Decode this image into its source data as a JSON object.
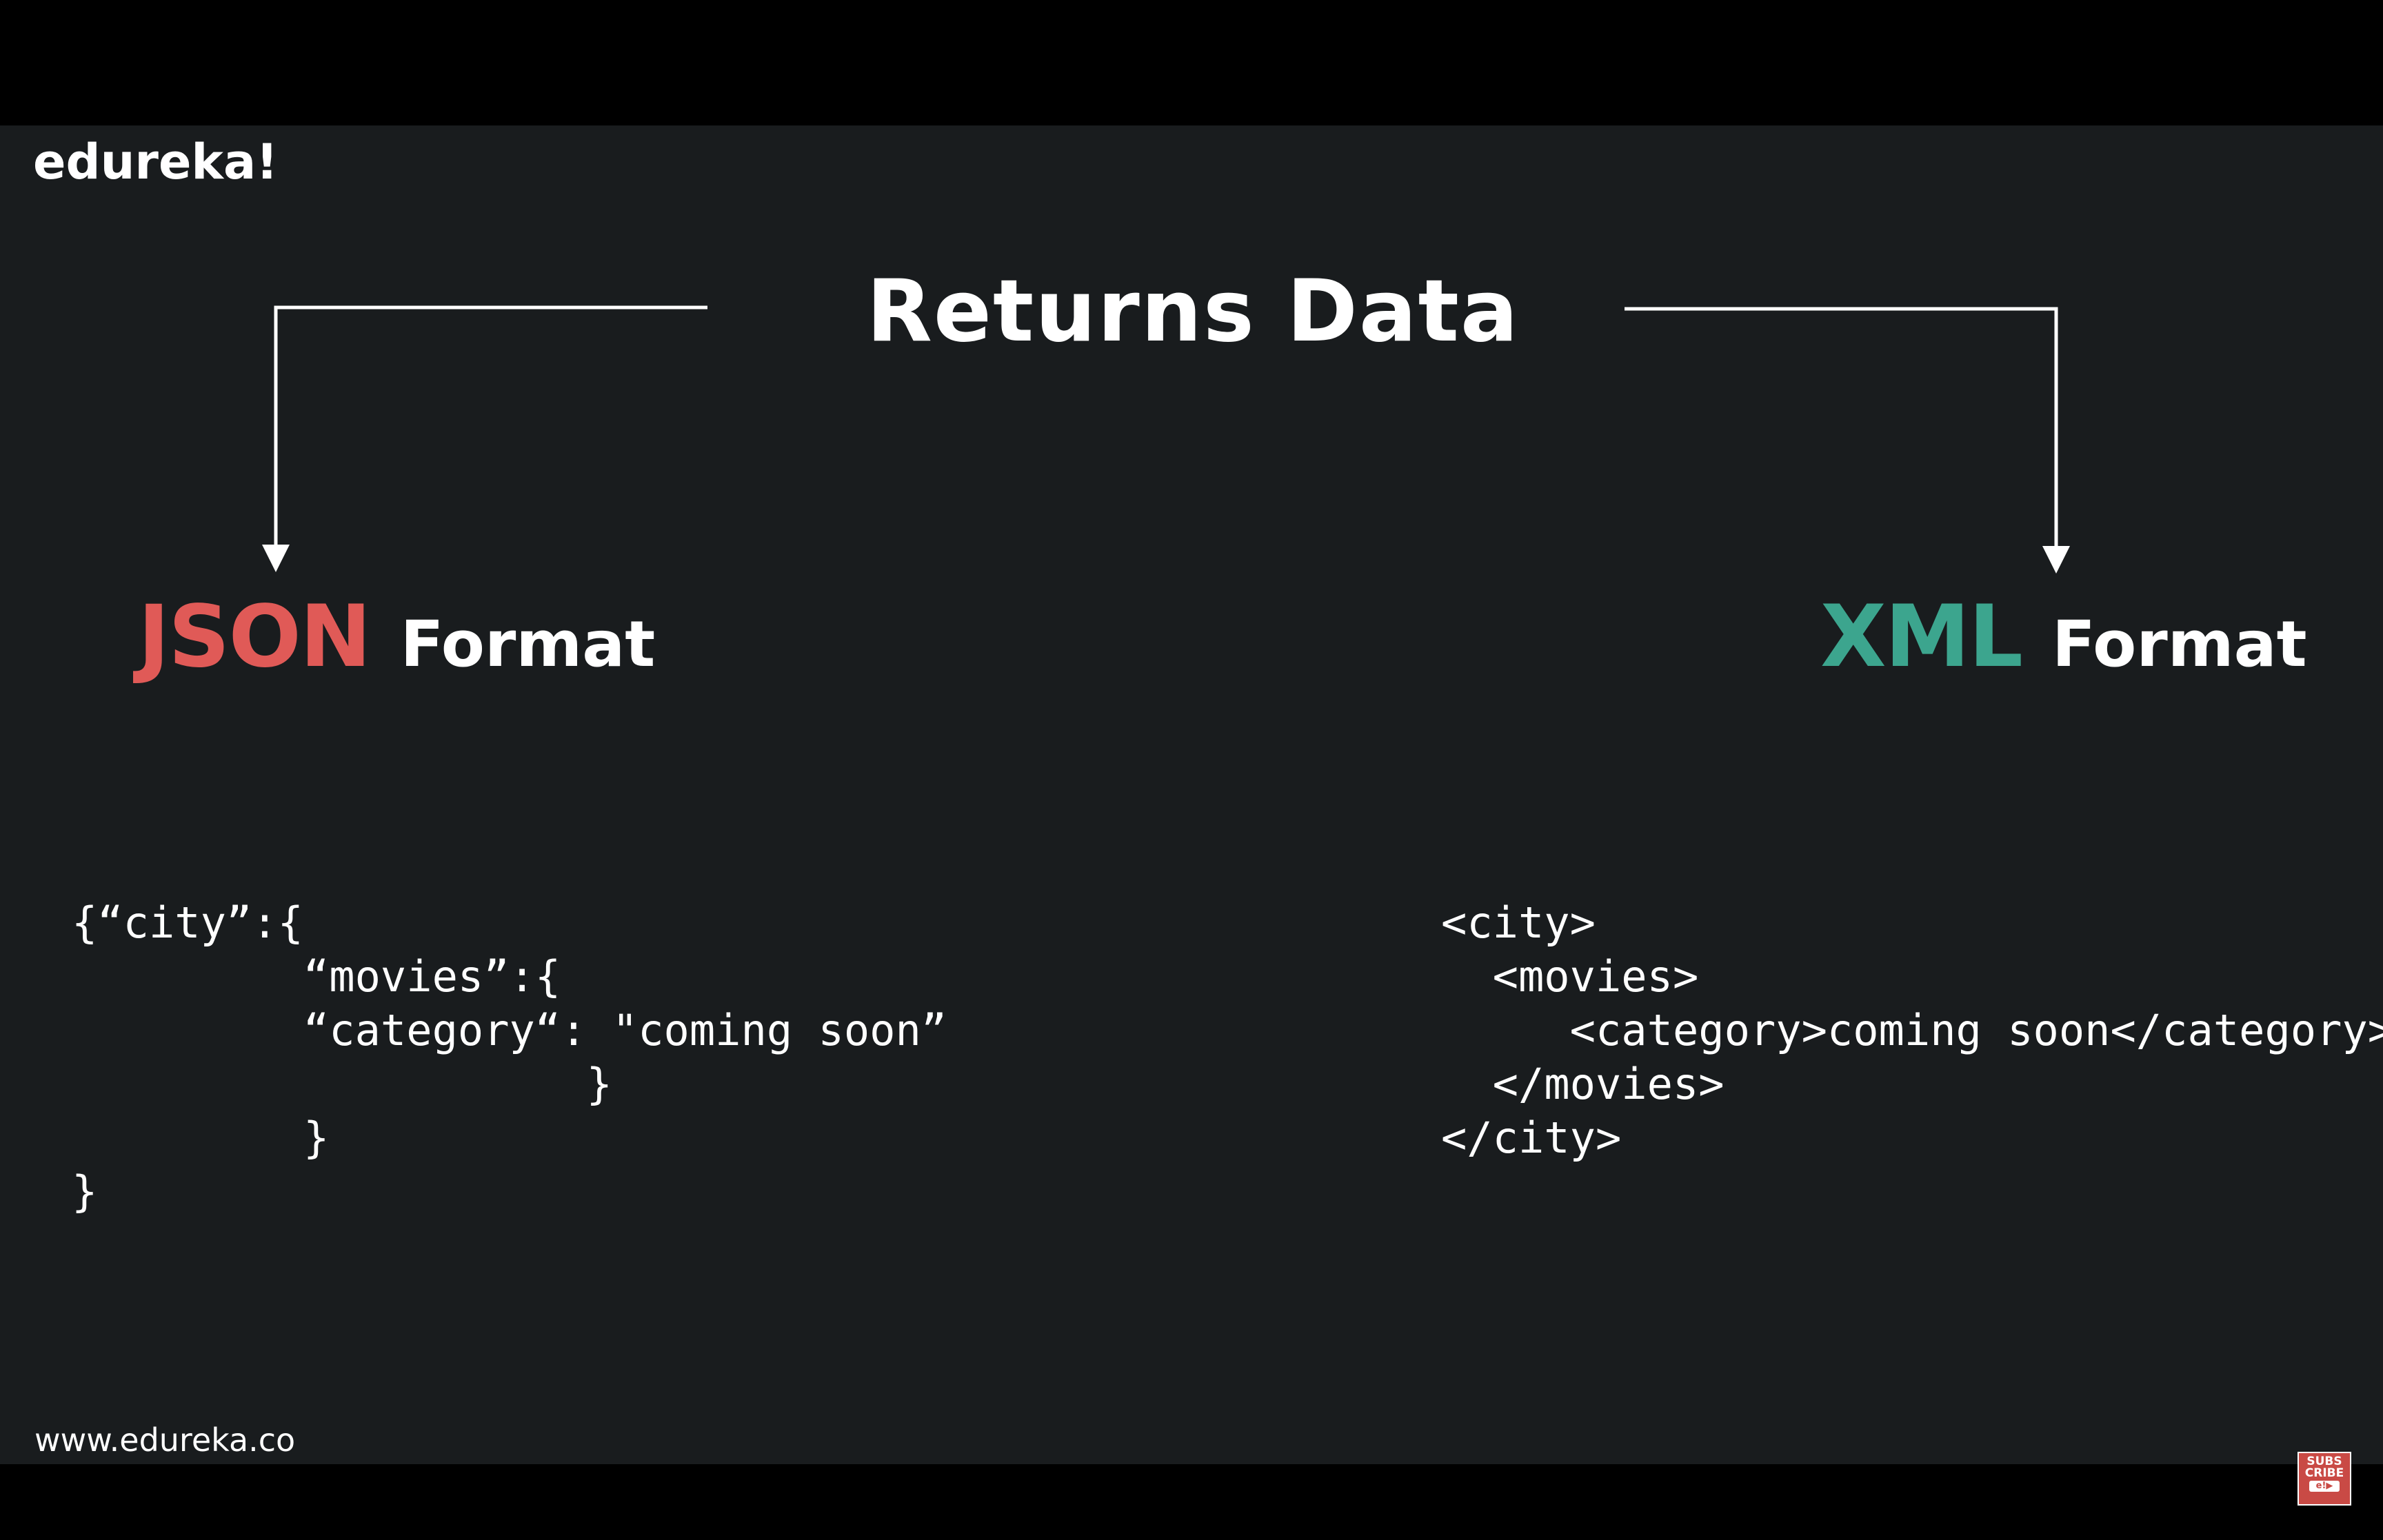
{
  "brand": {
    "logo_text": "edureka!",
    "url": "www.edureka.co"
  },
  "slide": {
    "title": "Returns Data",
    "json_section": {
      "accent": "JSON",
      "word": "Format",
      "accent_color": "#e05a57",
      "code_lines": [
        "{“city”:{",
        "         “movies”:{",
        "         “category“: \"coming soon”",
        "                    }",
        "         }",
        "}"
      ]
    },
    "xml_section": {
      "accent": "XML",
      "word": "Format",
      "accent_color": "#3ca58e",
      "code_lines": [
        "<city>",
        "  <movies>",
        "     <category>coming soon</category>",
        "  </movies>",
        "</city>"
      ]
    }
  },
  "subscribe_badge": {
    "line1": "SUBS",
    "line2": "CRIBE",
    "mini": "e!▶"
  },
  "colors": {
    "background": "#191c1e",
    "letterbox": "#000000",
    "text": "#ffffff"
  }
}
